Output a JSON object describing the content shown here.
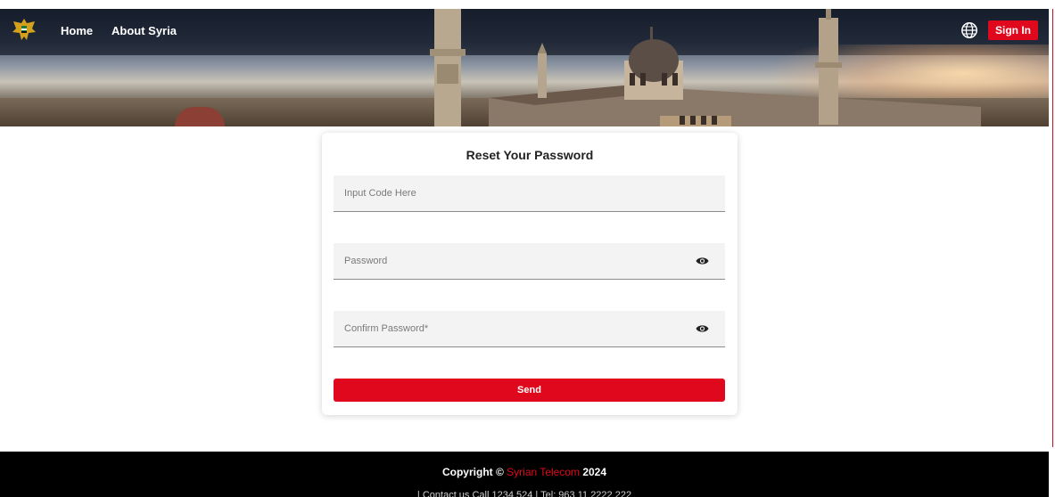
{
  "nav": {
    "home": "Home",
    "about": "About Syria",
    "language_icon": "globe-icon",
    "sign_in": "Sign In",
    "logo": "syrian-eagle-emblem"
  },
  "form": {
    "title": "Reset Your Password",
    "code_placeholder": "Input Code Here",
    "password_placeholder": "Password",
    "confirm_placeholder": "Confirm Password*",
    "toggle_icon": "eye-icon",
    "submit": "Send"
  },
  "footer": {
    "copyright_prefix": "Copyright © ",
    "brand": "Syrian Telecom",
    "year": " 2024",
    "contact_bar": "| Contact us  Call 1234 524  |  Tel: 963 11 2222 222"
  },
  "colors": {
    "accent": "#e0081c",
    "footer_bg": "#000000",
    "field_bg": "#f3f3f3"
  }
}
